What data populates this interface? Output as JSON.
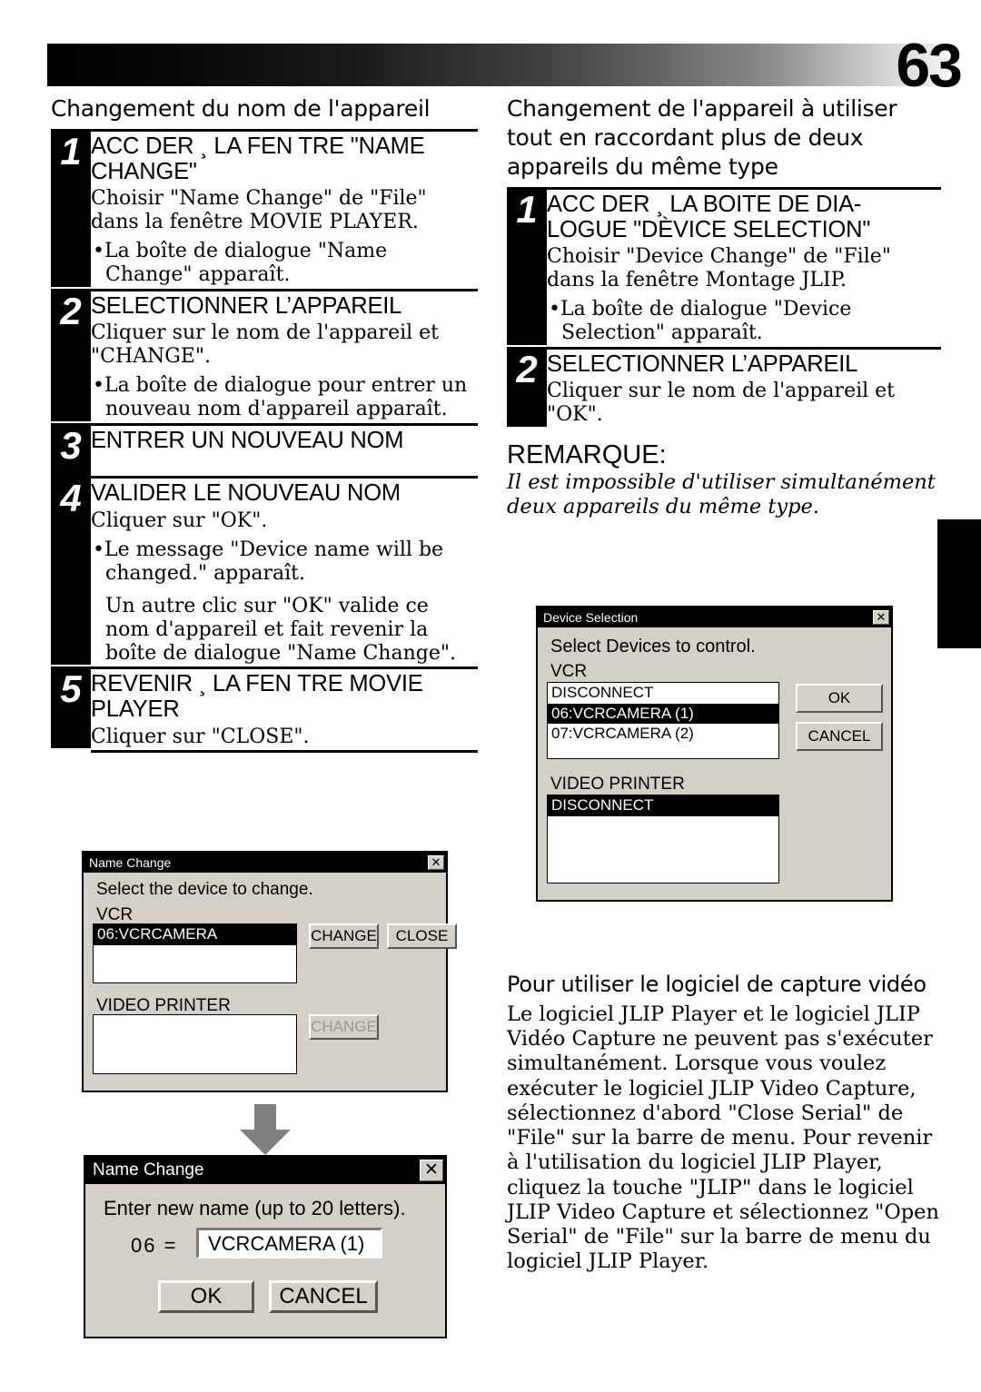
{
  "page": {
    "number": "63"
  },
  "left_column": {
    "section_title": "Changement du nom de l'appareil",
    "steps": [
      {
        "num": "1",
        "head": "ACC DER ¸ LA FEN TRE \"NAME CHANGE\"",
        "text": "Choisir \"Name Change\" de \"File\" dans la fenêtre MOVIE PLAYER.",
        "bullets": [
          "La boîte de dialogue \"Name Change\" apparaît."
        ]
      },
      {
        "num": "2",
        "head": "SELECTIONNER L’APPAREIL",
        "text": "Cliquer sur le nom de l'appareil et \"CHANGE\".",
        "bullets": [
          "La boîte de dialogue pour entrer un nouveau nom d'appareil apparaît."
        ]
      },
      {
        "num": "3",
        "head": "ENTRER UN NOUVEAU NOM",
        "text": "",
        "bullets": []
      },
      {
        "num": "4",
        "head": "VALIDER LE NOUVEAU NOM",
        "text": "Cliquer sur \"OK\".",
        "bullets": [
          "Le message \"Device name will be changed.\" apparaît."
        ],
        "plain": "Un autre clic sur \"OK\" valide ce nom d'appareil et fait revenir la boîte de dialogue \"Name Change\"."
      },
      {
        "num": "5",
        "head": "REVENIR ¸ LA FEN TRE MOVIE PLAYER",
        "text": "Cliquer sur \"CLOSE\".",
        "bullets": []
      }
    ]
  },
  "right_column": {
    "section_title": "Changement de l'appareil à utiliser tout en raccordant plus de deux appareils du même type",
    "steps": [
      {
        "num": "1",
        "head": "ACC DER ¸ LA BOITE DE DIA-LOGUE \"DÈVICE SELECTION\"",
        "text": "Choisir \"Device Change\" de \"File\" dans la fenêtre Montage JLIP.",
        "bullets": [
          "La boîte de dialogue \"Device Selection\" apparaît."
        ]
      },
      {
        "num": "2",
        "head": "SELECTIONNER L’APPAREIL",
        "text": "Cliquer sur le nom de l'appareil et \"OK\".",
        "bullets": []
      }
    ],
    "remarque": {
      "title": "REMARQUE:",
      "text": "Il est impossible d'utiliser simultanément deux appareils du même type."
    }
  },
  "capture_block": {
    "title": "Pour utiliser le logiciel de capture vidéo",
    "text": "Le logiciel JLIP Player et le logiciel JLIP Vidéo Capture ne peuvent pas s'exécuter simultanément. Lorsque vous voulez exécuter le logiciel JLIP Video Capture, sélectionnez d'abord \"Close Serial\" de \"File\" sur la barre de menu. Pour revenir à l'utilisation du logiciel JLIP Player, cliquez la touche \"JLIP\" dans le logiciel JLIP Video Capture et sélectionnez \"Open Serial\" de \"File\" sur la barre de menu du logiciel JLIP Player."
  },
  "dialogs": {
    "name_change_1": {
      "title": "Name Change",
      "close_glyph": "✕",
      "prompt": "Select the device to change.",
      "vcr_label": "VCR",
      "vcr_items": [
        {
          "label": "06:VCRCAMERA",
          "selected": true
        }
      ],
      "video_printer_label": "VIDEO PRINTER",
      "video_printer_items": [],
      "change_button": "CHANGE",
      "close_button": "CLOSE",
      "change_button_2": "CHANGE"
    },
    "name_change_2": {
      "title": "Name Change",
      "close_glyph": "✕",
      "prompt": "Enter new name (up to 20 letters).",
      "field_prefix": "06  =",
      "field_value": "VCRCAMERA (1)",
      "ok_button": "OK",
      "cancel_button": "CANCEL"
    },
    "device_selection": {
      "title": "Device Selection",
      "close_glyph": "✕",
      "prompt": "Select Devices to control.",
      "vcr_label": "VCR",
      "vcr_items": [
        {
          "label": "DISCONNECT",
          "selected": false
        },
        {
          "label": "06:VCRCAMERA (1)",
          "selected": true
        },
        {
          "label": "07:VCRCAMERA (2)",
          "selected": false
        }
      ],
      "video_printer_label": "VIDEO PRINTER",
      "video_printer_items": [
        {
          "label": "DISCONNECT",
          "selected": true
        }
      ],
      "ok_button": "OK",
      "cancel_button": "CANCEL"
    }
  },
  "colors": {
    "dialog_face": "#d4d0c8",
    "selection": "#000000",
    "arrow": "#808080"
  }
}
